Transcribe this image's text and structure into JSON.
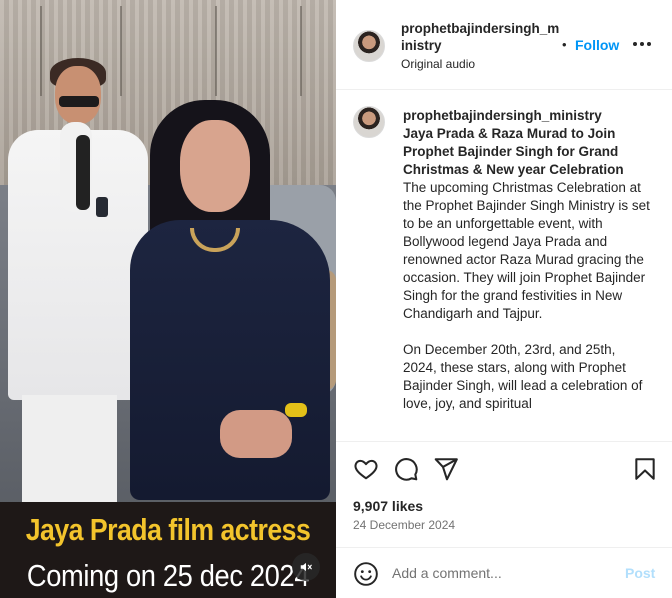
{
  "media": {
    "caption_line1": "Jaya Prada film actress",
    "caption_line2": "Coming on 25 dec 2024",
    "caption_line1_color": "#f3c42c",
    "caption_line2_color": "#ffffff",
    "mute_icon": "speaker-muted-icon"
  },
  "header": {
    "username": "prophetbajindersingh_ministry",
    "separator": "•",
    "follow_label": "Follow",
    "audio_label": "Original audio",
    "more_icon": "more-options-icon"
  },
  "caption": {
    "username": "prophetbajindersingh_ministry",
    "headline": "Jaya Prada & Raza Murad to Join Prophet Bajinder Singh for Grand Christmas & New year Celebration",
    "paragraph1": "The upcoming Christmas Celebration at the Prophet Bajinder Singh Ministry is set to be an unforgettable event, with Bollywood legend Jaya Prada and renowned actor Raza Murad gracing the occasion. They will join Prophet Bajinder Singh for the grand festivities in New Chandigarh and Tajpur.",
    "paragraph2": "On December 20th, 23rd, and 25th, 2024, these stars, along with Prophet Bajinder Singh, will lead a celebration of love, joy, and spiritual"
  },
  "actions": {
    "like_icon": "heart-icon",
    "comment_icon": "comment-icon",
    "share_icon": "share-icon",
    "save_icon": "bookmark-icon",
    "likes": "9,907 likes",
    "date": "24 December 2024"
  },
  "comment_bar": {
    "emoji_icon": "emoji-icon",
    "placeholder": "Add a comment...",
    "post_label": "Post"
  },
  "colors": {
    "accent": "#0095f6",
    "post_disabled": "#b2dffc",
    "caption_band": "#1e1817"
  }
}
